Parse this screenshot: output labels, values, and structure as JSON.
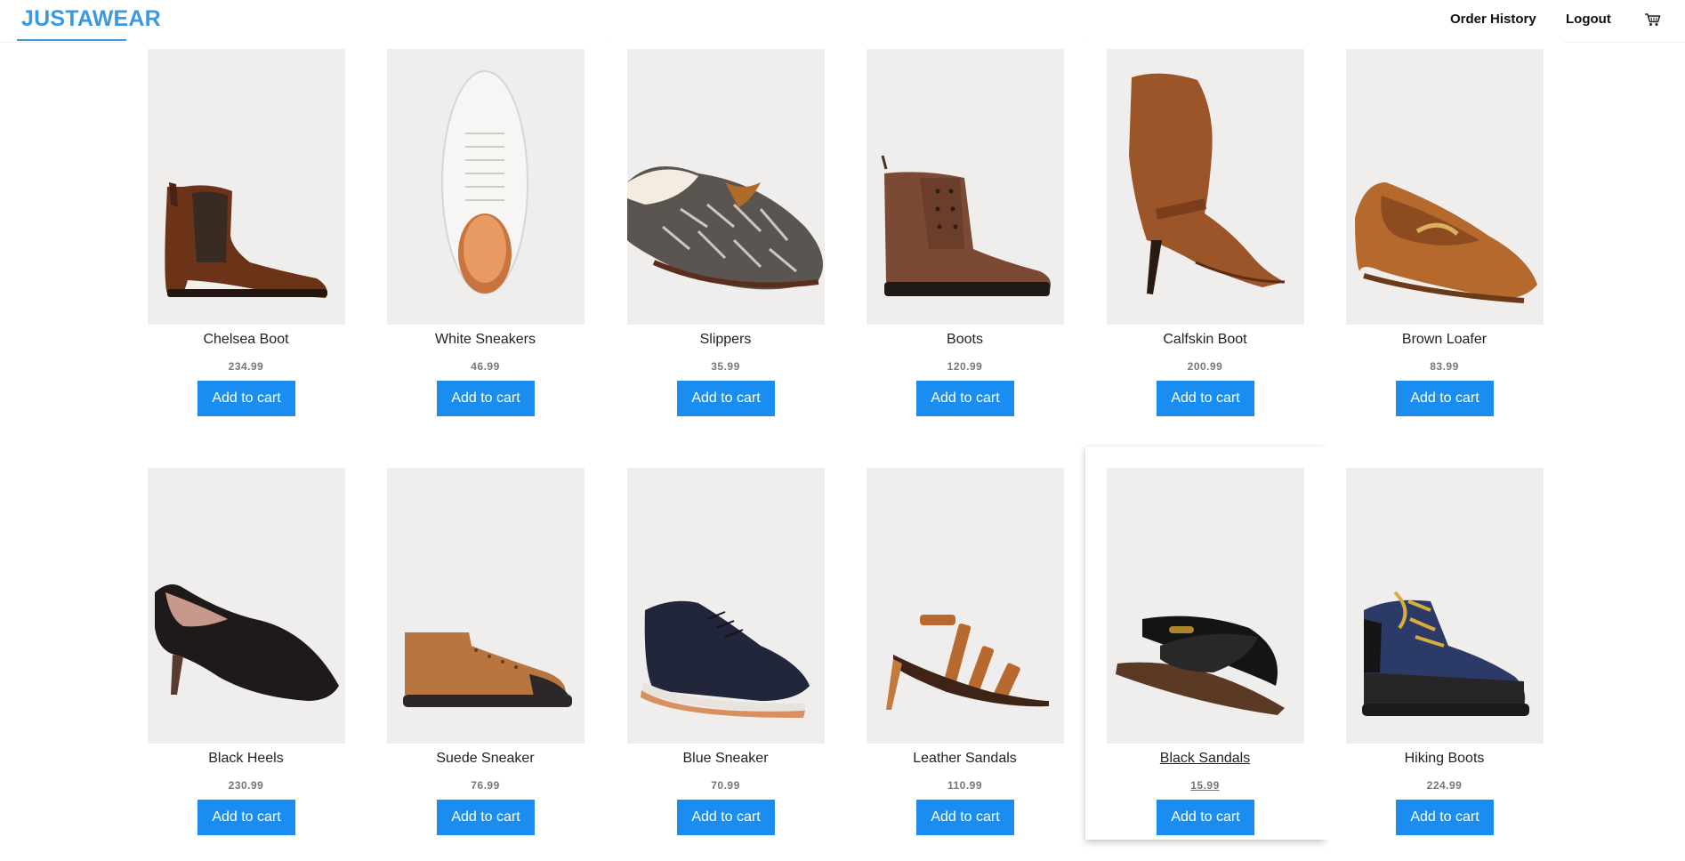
{
  "header": {
    "brand": "JUSTAWEAR",
    "order_history": "Order History",
    "logout": "Logout"
  },
  "colors": {
    "accent": "#3b99e0",
    "button": "#1a8ef0",
    "photo_bg": "#f0eeed"
  },
  "products": [
    {
      "name": "Chelsea Boot",
      "price": "234.99",
      "button": "Add to cart",
      "icon": "chelsea-boot-image"
    },
    {
      "name": "White Sneakers",
      "price": "46.99",
      "button": "Add to cart",
      "icon": "white-sneaker-image"
    },
    {
      "name": "Slippers",
      "price": "35.99",
      "button": "Add to cart",
      "icon": "slipper-image"
    },
    {
      "name": "Boots",
      "price": "120.99",
      "button": "Add to cart",
      "icon": "lace-up-boot-image"
    },
    {
      "name": "Calfskin Boot",
      "price": "200.99",
      "button": "Add to cart",
      "icon": "heeled-boot-image"
    },
    {
      "name": "Brown Loafer",
      "price": "83.99",
      "button": "Add to cart",
      "icon": "loafer-image"
    },
    {
      "name": "Black Heels",
      "price": "230.99",
      "button": "Add to cart",
      "icon": "pump-heel-image"
    },
    {
      "name": "Suede Sneaker",
      "price": "76.99",
      "button": "Add to cart",
      "icon": "suede-sneaker-image"
    },
    {
      "name": "Blue Sneaker",
      "price": "70.99",
      "button": "Add to cart",
      "icon": "blue-sneaker-image"
    },
    {
      "name": "Leather Sandals",
      "price": "110.99",
      "button": "Add to cart",
      "icon": "heeled-sandal-image"
    },
    {
      "name": "Black Sandals",
      "price": "15.99",
      "button": "Add to cart",
      "icon": "flat-sandal-image"
    },
    {
      "name": "Hiking Boots",
      "price": "224.99",
      "button": "Add to cart",
      "icon": "hiking-boot-image"
    }
  ]
}
